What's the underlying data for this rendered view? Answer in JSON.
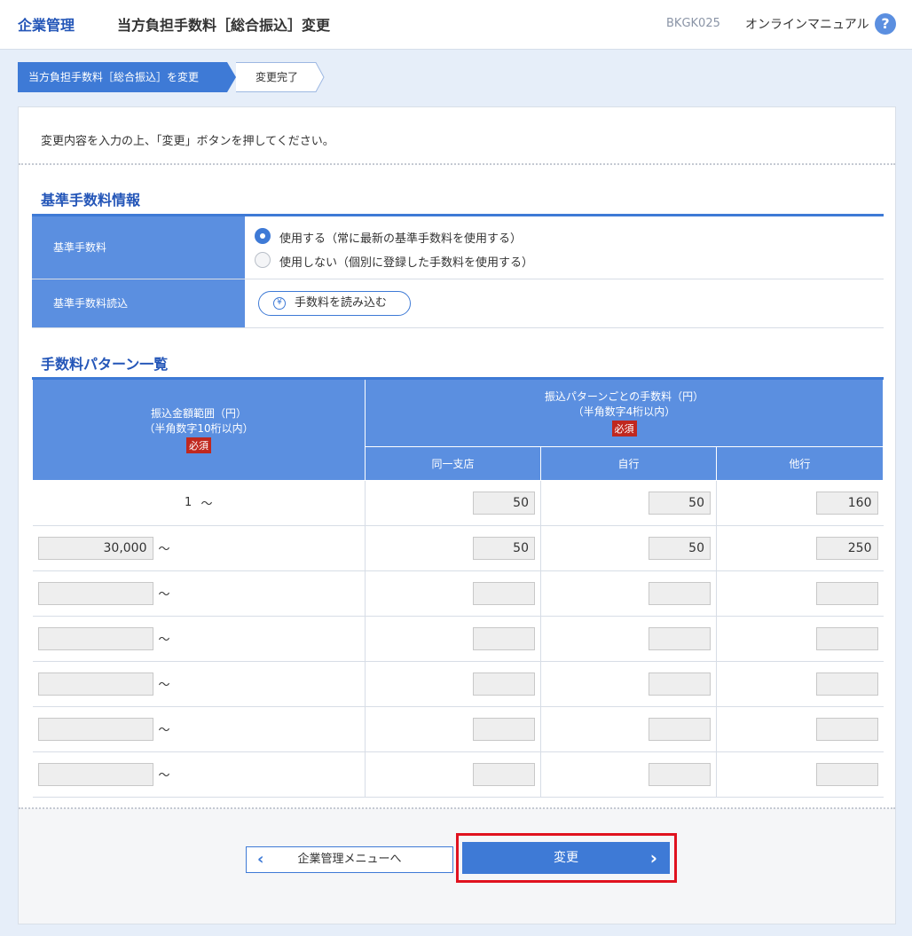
{
  "header": {
    "section": "企業管理",
    "title": "当方負担手数料［総合振込］変更",
    "screen_id": "BKGK025",
    "manual": "オンラインマニュアル",
    "help_glyph": "?"
  },
  "steps": [
    {
      "label": "当方負担手数料［総合振込］を変更",
      "active": true
    },
    {
      "label": "変更完了",
      "active": false
    }
  ],
  "instruction": "変更内容を入力の上、「変更」ボタンを押してください。",
  "base_info": {
    "title": "基準手数料情報",
    "fee_label": "基準手数料",
    "options": [
      {
        "label": "使用する（常に最新の基準手数料を使用する）",
        "selected": true
      },
      {
        "label": "使用しない（個別に登録した手数料を使用する）",
        "selected": false
      }
    ],
    "load_label": "基準手数料読込",
    "load_button": "手数料を読み込む",
    "load_icon_glyph": "¥"
  },
  "patterns": {
    "title": "手数料パターン一覧",
    "range_header": [
      "振込金額範囲（円）",
      "（半角数字10桁以内）"
    ],
    "fee_header": [
      "振込パターンごとの手数料（円）",
      "（半角数字4桁以内）"
    ],
    "required": "必須",
    "columns": [
      "同一支店",
      "自行",
      "他行"
    ],
    "tilde": "～",
    "rows": [
      {
        "from": "1",
        "same": "50",
        "own": "50",
        "other": "160"
      },
      {
        "from": "30,000",
        "same": "50",
        "own": "50",
        "other": "250"
      },
      {
        "from": "",
        "same": "",
        "own": "",
        "other": ""
      },
      {
        "from": "",
        "same": "",
        "own": "",
        "other": ""
      },
      {
        "from": "",
        "same": "",
        "own": "",
        "other": ""
      },
      {
        "from": "",
        "same": "",
        "own": "",
        "other": ""
      },
      {
        "from": "",
        "same": "",
        "own": "",
        "other": ""
      }
    ]
  },
  "buttons": {
    "back": "企業管理メニューへ",
    "back_chevron": "‹",
    "submit": "変更",
    "submit_chevron": "›"
  },
  "colors": {
    "primary": "#3e7ad6",
    "header_cell": "#5b8fe0",
    "required": "#c0281f",
    "highlight": "#e0121f"
  }
}
